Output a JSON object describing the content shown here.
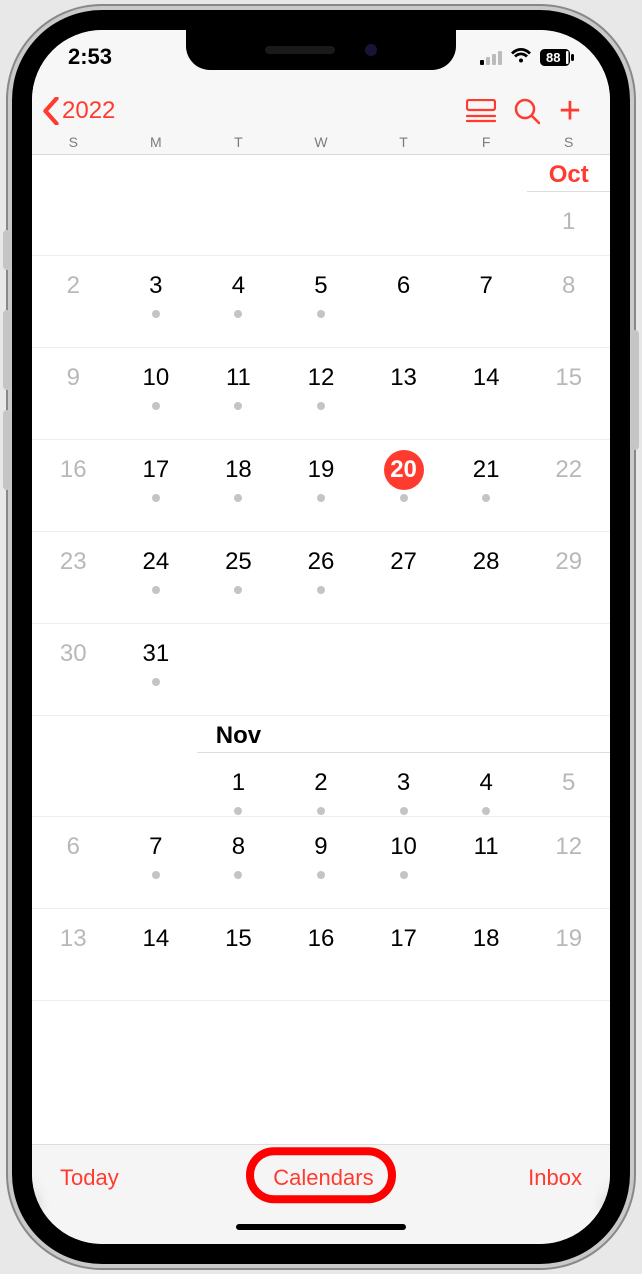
{
  "status": {
    "time": "2:53",
    "battery": "88"
  },
  "nav": {
    "back_label": "2022"
  },
  "weekdays": [
    "S",
    "M",
    "T",
    "W",
    "T",
    "F",
    "S"
  ],
  "months": {
    "oct": {
      "label": "Oct",
      "label_col": 6,
      "underline_from": 6,
      "weeks": [
        {
          "days": [
            {
              "n": "",
              "w": true
            },
            {
              "n": "",
              "w": false
            },
            {
              "n": "",
              "w": false
            },
            {
              "n": "",
              "w": false
            },
            {
              "n": "",
              "w": false
            },
            {
              "n": "",
              "w": false
            },
            {
              "n": "1",
              "w": true
            }
          ]
        },
        {
          "days": [
            {
              "n": "2",
              "w": true
            },
            {
              "n": "3",
              "d": true
            },
            {
              "n": "4",
              "d": true
            },
            {
              "n": "5",
              "d": true
            },
            {
              "n": "6"
            },
            {
              "n": "7"
            },
            {
              "n": "8",
              "w": true
            }
          ]
        },
        {
          "days": [
            {
              "n": "9",
              "w": true
            },
            {
              "n": "10",
              "d": true
            },
            {
              "n": "11",
              "d": true
            },
            {
              "n": "12",
              "d": true
            },
            {
              "n": "13"
            },
            {
              "n": "14"
            },
            {
              "n": "15",
              "w": true
            }
          ]
        },
        {
          "days": [
            {
              "n": "16",
              "w": true
            },
            {
              "n": "17",
              "d": true
            },
            {
              "n": "18",
              "d": true
            },
            {
              "n": "19",
              "d": true
            },
            {
              "n": "20",
              "d": true,
              "today": true
            },
            {
              "n": "21",
              "d": true
            },
            {
              "n": "22",
              "w": true
            }
          ]
        },
        {
          "days": [
            {
              "n": "23",
              "w": true
            },
            {
              "n": "24",
              "d": true
            },
            {
              "n": "25",
              "d": true
            },
            {
              "n": "26",
              "d": true
            },
            {
              "n": "27"
            },
            {
              "n": "28"
            },
            {
              "n": "29",
              "w": true
            }
          ]
        },
        {
          "days": [
            {
              "n": "30",
              "w": true
            },
            {
              "n": "31",
              "d": true
            },
            {
              "n": ""
            },
            {
              "n": ""
            },
            {
              "n": ""
            },
            {
              "n": ""
            },
            {
              "n": ""
            }
          ]
        }
      ]
    },
    "nov": {
      "label": "Nov",
      "label_col": 2,
      "underline_from": 2,
      "weeks": [
        {
          "days": [
            {
              "n": "",
              "w": true
            },
            {
              "n": ""
            },
            {
              "n": "1",
              "d": true
            },
            {
              "n": "2",
              "d": true
            },
            {
              "n": "3",
              "d": true
            },
            {
              "n": "4",
              "d": true
            },
            {
              "n": "5",
              "w": true
            }
          ]
        },
        {
          "days": [
            {
              "n": "6",
              "w": true
            },
            {
              "n": "7",
              "d": true
            },
            {
              "n": "8",
              "d": true
            },
            {
              "n": "9",
              "d": true
            },
            {
              "n": "10",
              "d": true
            },
            {
              "n": "11"
            },
            {
              "n": "12",
              "w": true
            }
          ]
        },
        {
          "days": [
            {
              "n": "13",
              "w": true
            },
            {
              "n": "14"
            },
            {
              "n": "15"
            },
            {
              "n": "16"
            },
            {
              "n": "17"
            },
            {
              "n": "18"
            },
            {
              "n": "19",
              "w": true
            }
          ]
        }
      ]
    }
  },
  "toolbar": {
    "today": "Today",
    "calendars": "Calendars",
    "inbox": "Inbox"
  },
  "colors": {
    "accent": "#ff3b30"
  }
}
